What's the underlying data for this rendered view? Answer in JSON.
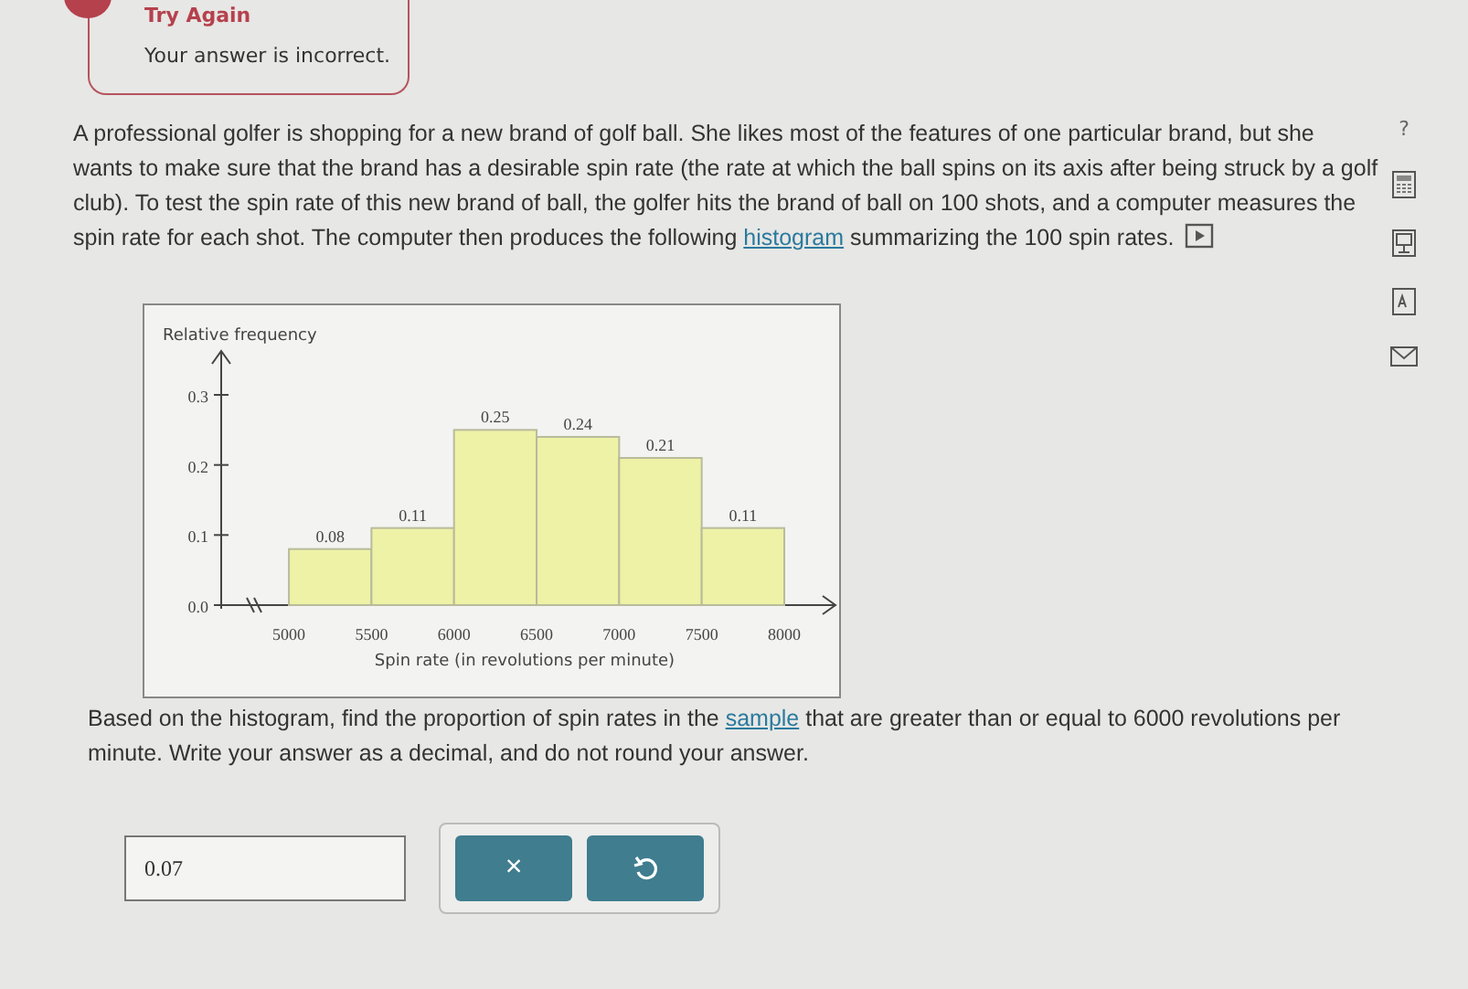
{
  "feedback": {
    "title": "Try Again",
    "message": "Your answer is incorrect."
  },
  "question": {
    "before": "A professional golfer is shopping for a new brand of golf ball. She likes most of the features of one particular brand, but she wants to make sure that the brand has a desirable spin rate (the rate at which the ball spins on its axis after being struck by a golf club). To test the spin rate of this new brand of ball, the golfer hits the brand of ball on 100 shots, and a computer measures the spin rate for each shot. The computer then produces the following",
    "link": "histogram",
    "after": "summarizing the 100 spin rates."
  },
  "help": {
    "label": "?"
  },
  "chart": {
    "chart_data": {
      "type": "bar",
      "ylabel": "Relative frequency",
      "xlabel": "Spin rate (in revolutions per minute)",
      "x": [
        5250,
        5750,
        6250,
        6750,
        7250,
        7750
      ],
      "values": [
        0.08,
        0.11,
        0.25,
        0.24,
        0.21,
        0.11
      ],
      "xlim": [
        4590,
        8310
      ],
      "ylim": [
        0,
        0.36
      ],
      "xticks": [
        5000,
        5500,
        6000,
        6500,
        7000,
        7500,
        8000
      ],
      "yticks": [
        {
          "value": 0,
          "label": "0.0"
        },
        {
          "value": 0.1,
          "label": "0.1"
        },
        {
          "value": 0.2,
          "label": "0.2"
        },
        {
          "value": 0.3,
          "label": "0.3"
        }
      ],
      "data_labels": true
    }
  },
  "prompt": {
    "before": "Based on the histogram, find the proportion of spin rates in the",
    "link": "sample",
    "after": "that are greater than or equal to 6000 revolutions per minute. Write your answer as a decimal, and do not round your answer."
  },
  "answer": {
    "value": "0.07"
  },
  "buttons": [
    {
      "kind": "clear",
      "label": "×"
    },
    {
      "kind": "undo"
    }
  ]
}
